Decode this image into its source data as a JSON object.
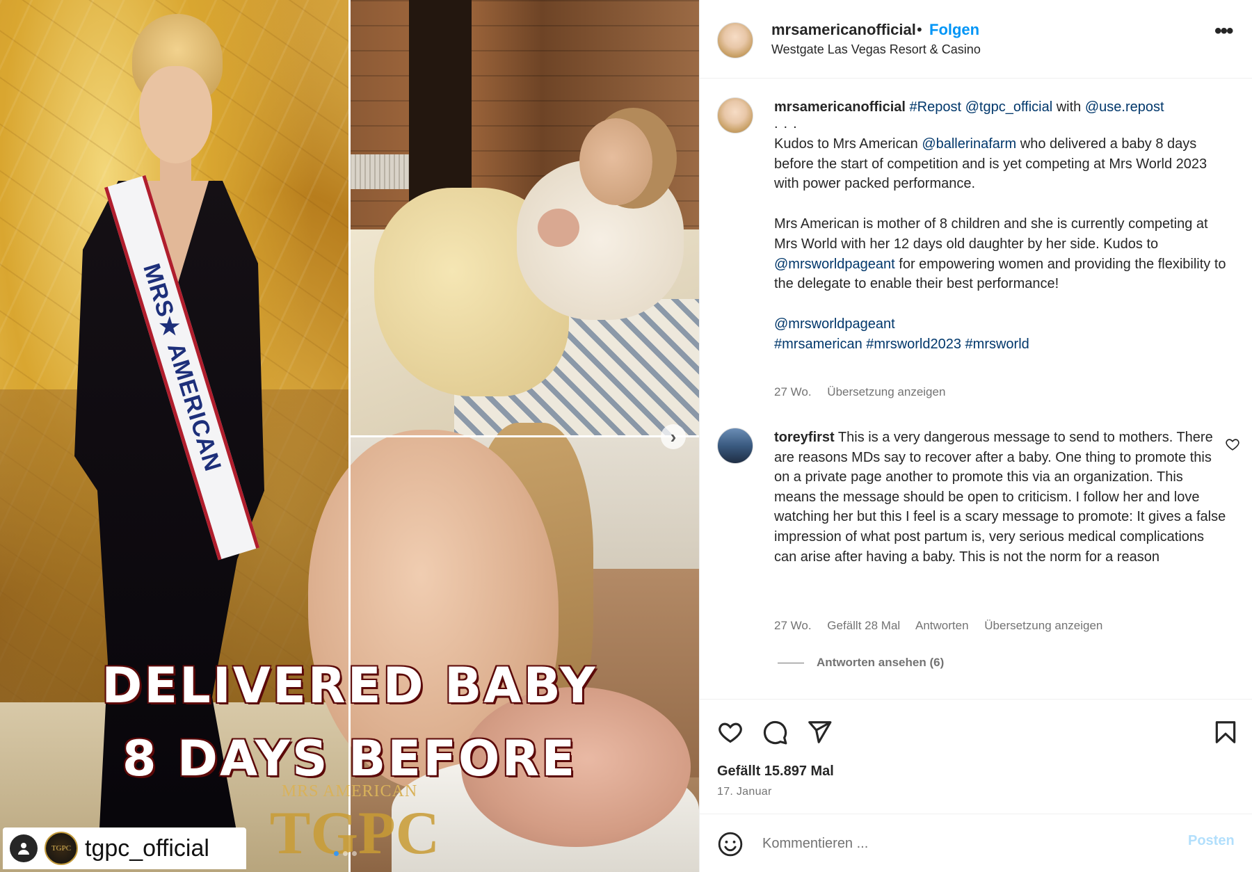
{
  "media": {
    "overlay_line1": "DELIVERED BABY",
    "overlay_line2": "8 DAYS BEFORE",
    "overlay_sub": "MRS AMERICAN",
    "overlay_logo": "TGPC",
    "sash_text": "MRS★ AMERICAN",
    "watermark_account": "tgpc_official",
    "watermark_avatar_text": "TGPC",
    "carousel": {
      "total": 3,
      "active": 1
    }
  },
  "post_header": {
    "username": "mrsamericanofficial",
    "bullet": "•",
    "follow_label": "Folgen",
    "location": "Westgate Las Vegas Resort & Casino",
    "more_icon": "more-horizontal-icon"
  },
  "caption": {
    "username": "mrsamericanofficial",
    "repost_tag": "#Repost",
    "repost_user": "@tgpc_official",
    "with_word": "with",
    "via_user": "@use.repost",
    "ellipsis": "...",
    "para1_a": "Kudos to Mrs American ",
    "para1_mention": "@ballerinafarm",
    "para1_b": " who delivered a baby 8 days before the start of competition and is yet competing at Mrs World 2023 with power packed performance.",
    "para2_a": "Mrs American is mother of 8 children and she is currently competing at Mrs World with her 12 days old daughter by her side. Kudos to ",
    "para2_mention": "@mrsworldpageant",
    "para2_b": " for empowering women and providing the flexibility to the delegate to enable their best performance!",
    "tag_mention": "@mrsworldpageant",
    "hashtags": "#mrsamerican #mrsworld2023 #mrsworld",
    "time": "27 Wo.",
    "translate": "Übersetzung anzeigen"
  },
  "comment": {
    "username": "toreyfirst",
    "text": "This is a very dangerous message to send to mothers. There are reasons MDs say to recover after a baby. One thing to promote this on a private page another to promote this via an organization. This means the message should be open to criticism. I follow her and love watching her but this I feel is a scary message to promote: It gives a false impression of what post partum is, very serious medical complications can arise after having a baby. This is not the norm for a reason",
    "time": "27 Wo.",
    "likes": "Gefällt 28 Mal",
    "reply": "Antworten",
    "translate": "Übersetzung anzeigen",
    "view_replies": "Antworten ansehen (6)"
  },
  "actions": {
    "like_icon": "heart-icon",
    "comment_icon": "comment-icon",
    "share_icon": "send-icon",
    "save_icon": "bookmark-icon",
    "likes_text": "Gefällt 15.897 Mal",
    "date": "17. Januar"
  },
  "add_comment": {
    "placeholder": "Kommentieren ...",
    "post_label": "Posten"
  },
  "colors": {
    "link": "#00376b",
    "follow": "#0095f6",
    "muted": "#737373",
    "post_disabled": "#b2dffc"
  }
}
